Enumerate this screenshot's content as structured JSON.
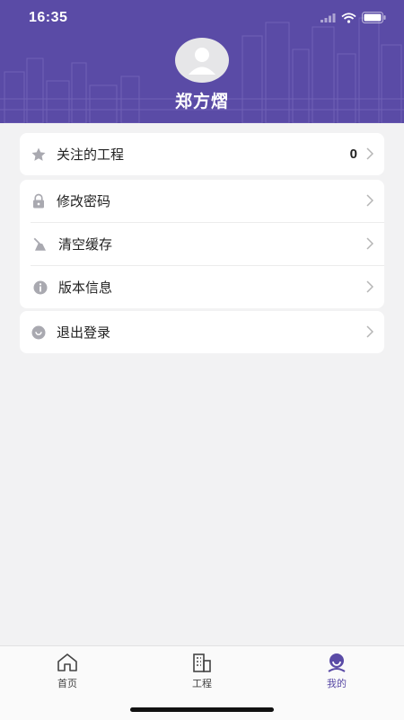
{
  "status_bar": {
    "time": "16:35"
  },
  "profile": {
    "name": "郑方熠"
  },
  "menu": {
    "follow": {
      "label": "关注的工程",
      "value": "0"
    },
    "change_password": {
      "label": "修改密码"
    },
    "clear_cache": {
      "label": "清空缓存"
    },
    "version_info": {
      "label": "版本信息"
    },
    "logout": {
      "label": "退出登录"
    }
  },
  "tabbar": [
    {
      "label": "首页",
      "icon": "home-icon"
    },
    {
      "label": "工程",
      "icon": "building-icon"
    },
    {
      "label": "我的",
      "icon": "person-icon"
    }
  ],
  "colors": {
    "accent": "#5a4ba6",
    "background": "#f2f2f3",
    "icon_gray": "#a9a9b0"
  }
}
